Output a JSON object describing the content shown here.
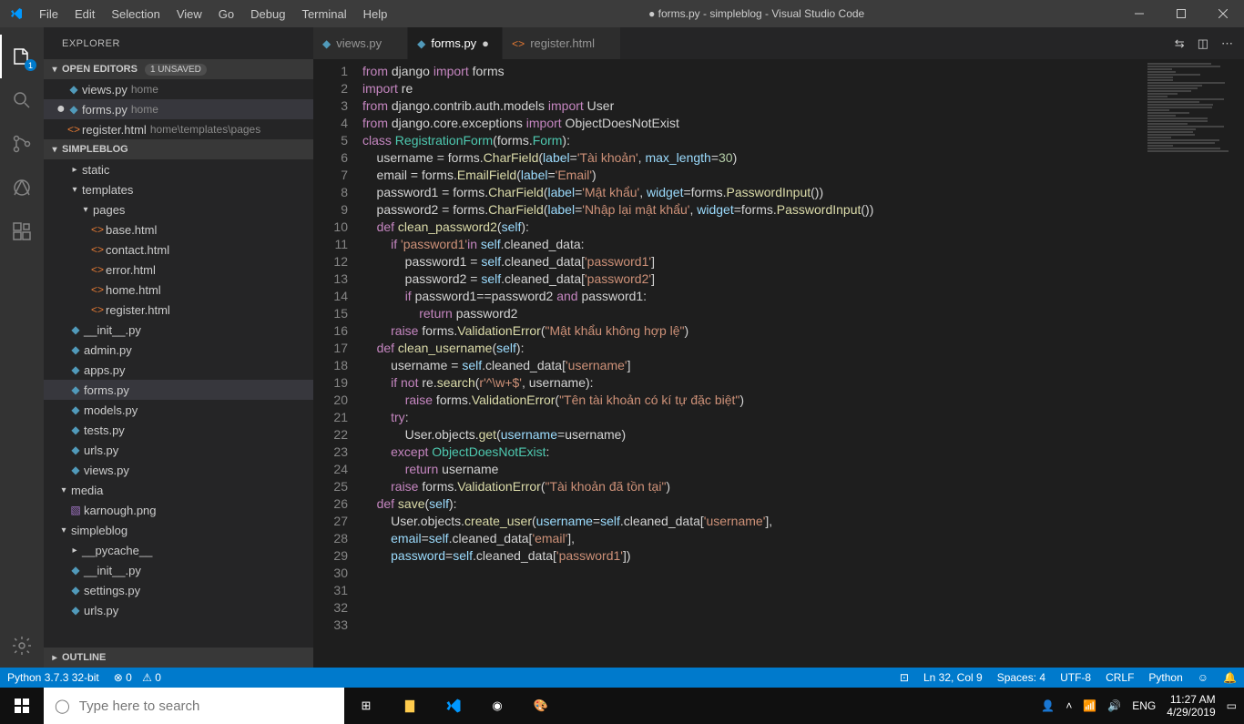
{
  "title": "● forms.py - simpleblog - Visual Studio Code",
  "menu": [
    "File",
    "Edit",
    "Selection",
    "View",
    "Go",
    "Debug",
    "Terminal",
    "Help"
  ],
  "activity_badge": "1",
  "explorer": {
    "title": "EXPLORER",
    "openEditors": {
      "label": "OPEN EDITORS",
      "badge": "1 UNSAVED"
    },
    "editors": [
      {
        "name": "views.py",
        "path": "home",
        "type": "py",
        "dirty": false
      },
      {
        "name": "forms.py",
        "path": "home",
        "type": "py",
        "dirty": true,
        "sel": true
      },
      {
        "name": "register.html",
        "path": "home\\templates\\pages",
        "type": "html",
        "dirty": false
      }
    ],
    "project": "SIMPLEBLOG",
    "tree": [
      {
        "d": 1,
        "t": "folder",
        "n": "static",
        "exp": false
      },
      {
        "d": 1,
        "t": "folder",
        "n": "templates",
        "exp": true
      },
      {
        "d": 2,
        "t": "folder",
        "n": "pages",
        "exp": true
      },
      {
        "d": 3,
        "t": "html",
        "n": "base.html"
      },
      {
        "d": 3,
        "t": "html",
        "n": "contact.html"
      },
      {
        "d": 3,
        "t": "html",
        "n": "error.html"
      },
      {
        "d": 3,
        "t": "html",
        "n": "home.html"
      },
      {
        "d": 3,
        "t": "html",
        "n": "register.html"
      },
      {
        "d": 1,
        "t": "py",
        "n": "__init__.py"
      },
      {
        "d": 1,
        "t": "py",
        "n": "admin.py"
      },
      {
        "d": 1,
        "t": "py",
        "n": "apps.py"
      },
      {
        "d": 1,
        "t": "py",
        "n": "forms.py",
        "sel": true
      },
      {
        "d": 1,
        "t": "py",
        "n": "models.py"
      },
      {
        "d": 1,
        "t": "py",
        "n": "tests.py"
      },
      {
        "d": 1,
        "t": "py",
        "n": "urls.py"
      },
      {
        "d": 1,
        "t": "py",
        "n": "views.py"
      },
      {
        "d": 0,
        "t": "folder",
        "n": "media",
        "exp": true
      },
      {
        "d": 1,
        "t": "img",
        "n": "karnough.png"
      },
      {
        "d": 0,
        "t": "folder",
        "n": "simpleblog",
        "exp": true
      },
      {
        "d": 1,
        "t": "folder",
        "n": "__pycache__",
        "exp": false
      },
      {
        "d": 1,
        "t": "py",
        "n": "__init__.py"
      },
      {
        "d": 1,
        "t": "py",
        "n": "settings.py"
      },
      {
        "d": 1,
        "t": "py",
        "n": "urls.py"
      }
    ],
    "outline": "OUTLINE"
  },
  "tabs": [
    {
      "name": "views.py",
      "type": "py",
      "active": false,
      "dirty": false
    },
    {
      "name": "forms.py",
      "type": "py",
      "active": true,
      "dirty": true
    },
    {
      "name": "register.html",
      "type": "html",
      "active": false,
      "dirty": false
    }
  ],
  "code": {
    "lines": [
      [
        [
          "k",
          "from"
        ],
        [
          "",
          " django "
        ],
        [
          "k",
          "import"
        ],
        [
          "",
          " forms"
        ]
      ],
      [
        [
          "k",
          "import"
        ],
        [
          "",
          " re"
        ]
      ],
      [
        [
          "k",
          "from"
        ],
        [
          "",
          " django.contrib.auth.models "
        ],
        [
          "k",
          "import"
        ],
        [
          "",
          " User"
        ]
      ],
      [
        [
          "k",
          "from"
        ],
        [
          "",
          " django.core.exceptions "
        ],
        [
          "k",
          "import"
        ],
        [
          "",
          " ObjectDoesNotExist"
        ]
      ],
      [
        [
          "",
          ""
        ]
      ],
      [
        [
          "k",
          "class"
        ],
        [
          "",
          " "
        ],
        [
          "cn",
          "RegistrationForm"
        ],
        [
          "",
          "(forms."
        ],
        [
          "cn",
          "Form"
        ],
        [
          "",
          "):"
        ]
      ],
      [
        [
          "",
          "    username = forms."
        ],
        [
          "fn",
          "CharField"
        ],
        [
          "",
          "("
        ],
        [
          "vb",
          "label"
        ],
        [
          "",
          "="
        ],
        [
          "s",
          "'Tài khoản'"
        ],
        [
          "",
          ", "
        ],
        [
          "vb",
          "max_length"
        ],
        [
          "",
          "="
        ],
        [
          "nm",
          "30"
        ],
        [
          "",
          ")"
        ]
      ],
      [
        [
          "",
          "    email = forms."
        ],
        [
          "fn",
          "EmailField"
        ],
        [
          "",
          "("
        ],
        [
          "vb",
          "label"
        ],
        [
          "",
          "="
        ],
        [
          "s",
          "'Email'"
        ],
        [
          "",
          ")"
        ]
      ],
      [
        [
          "",
          "    password1 = forms."
        ],
        [
          "fn",
          "CharField"
        ],
        [
          "",
          "("
        ],
        [
          "vb",
          "label"
        ],
        [
          "",
          "="
        ],
        [
          "s",
          "'Mật khẩu'"
        ],
        [
          "",
          ", "
        ],
        [
          "vb",
          "widget"
        ],
        [
          "",
          "=forms."
        ],
        [
          "fn",
          "PasswordInput"
        ],
        [
          "",
          "())"
        ]
      ],
      [
        [
          "",
          "    password2 = forms."
        ],
        [
          "fn",
          "CharField"
        ],
        [
          "",
          "("
        ],
        [
          "vb",
          "label"
        ],
        [
          "",
          "="
        ],
        [
          "s",
          "'Nhập lại mật khẩu'"
        ],
        [
          "",
          ", "
        ],
        [
          "vb",
          "widget"
        ],
        [
          "",
          "=forms."
        ],
        [
          "fn",
          "PasswordInput"
        ],
        [
          "",
          "())"
        ]
      ],
      [
        [
          "",
          ""
        ]
      ],
      [
        [
          "",
          "    "
        ],
        [
          "k",
          "def"
        ],
        [
          "",
          " "
        ],
        [
          "fn",
          "clean_password2"
        ],
        [
          "",
          "("
        ],
        [
          "vb",
          "self"
        ],
        [
          "",
          "):"
        ]
      ],
      [
        [
          "",
          "        "
        ],
        [
          "k",
          "if"
        ],
        [
          "",
          " "
        ],
        [
          "s",
          "'password1'"
        ],
        [
          "k",
          "in"
        ],
        [
          "",
          " "
        ],
        [
          "vb",
          "self"
        ],
        [
          "",
          ".cleaned_data:"
        ]
      ],
      [
        [
          "",
          "            password1 = "
        ],
        [
          "vb",
          "self"
        ],
        [
          "",
          ".cleaned_data["
        ],
        [
          "s",
          "'password1'"
        ],
        [
          "",
          "]"
        ]
      ],
      [
        [
          "",
          "            password2 = "
        ],
        [
          "vb",
          "self"
        ],
        [
          "",
          ".cleaned_data["
        ],
        [
          "s",
          "'password2'"
        ],
        [
          "",
          "]"
        ]
      ],
      [
        [
          "",
          "            "
        ],
        [
          "k",
          "if"
        ],
        [
          "",
          " password1==password2 "
        ],
        [
          "k",
          "and"
        ],
        [
          "",
          " password1:"
        ]
      ],
      [
        [
          "",
          "                "
        ],
        [
          "k",
          "return"
        ],
        [
          "",
          " password2"
        ]
      ],
      [
        [
          "",
          "        "
        ],
        [
          "k",
          "raise"
        ],
        [
          "",
          " forms."
        ],
        [
          "fn",
          "ValidationError"
        ],
        [
          "",
          "("
        ],
        [
          "s",
          "\"Mật khẩu không hợp lệ\""
        ],
        [
          "",
          ")"
        ]
      ],
      [
        [
          "",
          ""
        ]
      ],
      [
        [
          "",
          "    "
        ],
        [
          "k",
          "def"
        ],
        [
          "",
          " "
        ],
        [
          "fn",
          "clean_username"
        ],
        [
          "",
          "("
        ],
        [
          "vb",
          "self"
        ],
        [
          "",
          "):"
        ]
      ],
      [
        [
          "",
          "        username = "
        ],
        [
          "vb",
          "self"
        ],
        [
          "",
          ".cleaned_data["
        ],
        [
          "s",
          "'username'"
        ],
        [
          "",
          "]"
        ]
      ],
      [
        [
          "",
          "        "
        ],
        [
          "k",
          "if"
        ],
        [
          "",
          " "
        ],
        [
          "k",
          "not"
        ],
        [
          "",
          " re."
        ],
        [
          "fn",
          "search"
        ],
        [
          "",
          "("
        ],
        [
          "s",
          "r'^\\w+$'"
        ],
        [
          "",
          ", username):"
        ]
      ],
      [
        [
          "",
          "            "
        ],
        [
          "k",
          "raise"
        ],
        [
          "",
          " forms."
        ],
        [
          "fn",
          "ValidationError"
        ],
        [
          "",
          "("
        ],
        [
          "s",
          "\"Tên tài khoản có kí tự đặc biệt\""
        ],
        [
          "",
          ")"
        ]
      ],
      [
        [
          "",
          "        "
        ],
        [
          "k",
          "try"
        ],
        [
          "",
          ":"
        ]
      ],
      [
        [
          "",
          "            User.objects."
        ],
        [
          "fn",
          "get"
        ],
        [
          "",
          "("
        ],
        [
          "vb",
          "username"
        ],
        [
          "",
          "=username)"
        ]
      ],
      [
        [
          "",
          "        "
        ],
        [
          "k",
          "except"
        ],
        [
          "",
          " "
        ],
        [
          "cn",
          "ObjectDoesNotExist"
        ],
        [
          "",
          ":"
        ]
      ],
      [
        [
          "",
          "            "
        ],
        [
          "k",
          "return"
        ],
        [
          "",
          " username"
        ]
      ],
      [
        [
          "",
          "        "
        ],
        [
          "k",
          "raise"
        ],
        [
          "",
          " forms."
        ],
        [
          "fn",
          "ValidationError"
        ],
        [
          "",
          "("
        ],
        [
          "s",
          "\"Tài khoản đã tồn tại\""
        ],
        [
          "",
          ")"
        ]
      ],
      [
        [
          "",
          ""
        ]
      ],
      [
        [
          "",
          "    "
        ],
        [
          "k",
          "def"
        ],
        [
          "",
          " "
        ],
        [
          "fn",
          "save"
        ],
        [
          "",
          "("
        ],
        [
          "vb",
          "self"
        ],
        [
          "",
          "):"
        ]
      ],
      [
        [
          "",
          "        User.objects."
        ],
        [
          "fn",
          "create_user"
        ],
        [
          "",
          "("
        ],
        [
          "vb",
          "username"
        ],
        [
          "",
          "="
        ],
        [
          "vb",
          "self"
        ],
        [
          "",
          ".cleaned_data["
        ],
        [
          "s",
          "'username'"
        ],
        [
          "",
          "],"
        ]
      ],
      [
        [
          "",
          "        "
        ],
        [
          "vb",
          "email"
        ],
        [
          "",
          "="
        ],
        [
          "vb",
          "self"
        ],
        [
          "",
          ".cleaned_data["
        ],
        [
          "s",
          "'email'"
        ],
        [
          "",
          "],"
        ]
      ],
      [
        [
          "",
          "        "
        ],
        [
          "vb",
          "password"
        ],
        [
          "",
          "="
        ],
        [
          "vb",
          "self"
        ],
        [
          "",
          ".cleaned_data["
        ],
        [
          "s",
          "'password1'"
        ],
        [
          "",
          "])"
        ]
      ]
    ]
  },
  "status": {
    "left": [
      "Python 3.7.3 32-bit",
      "⊗ 0",
      "⚠ 0"
    ],
    "right": [
      "Ln 32, Col 9",
      "Spaces: 4",
      "UTF-8",
      "CRLF",
      "Python",
      "☺",
      "🔔"
    ],
    "feedback": "⊡"
  },
  "taskbar": {
    "search": "Type here to search",
    "lang": "ENG",
    "time": "11:27 AM",
    "date": "4/29/2019"
  }
}
